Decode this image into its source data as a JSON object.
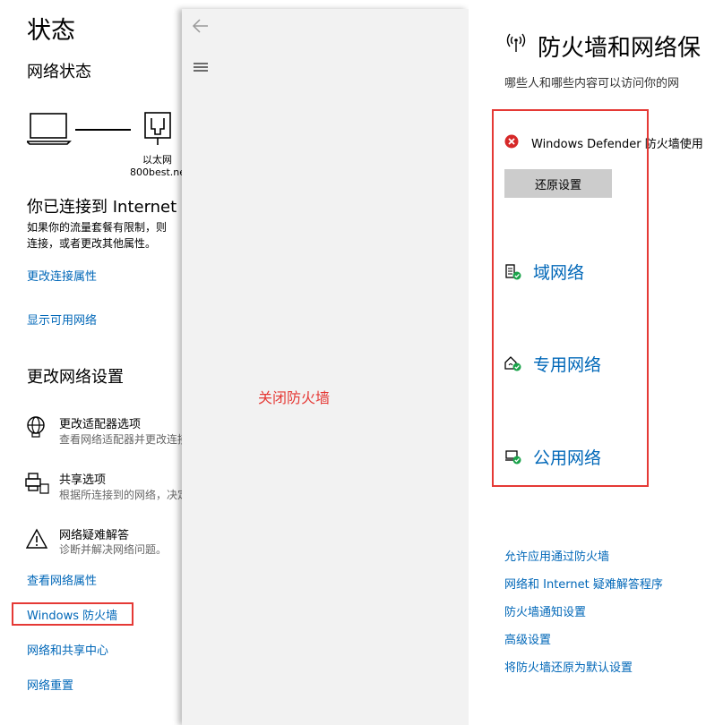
{
  "status_panel": {
    "title": "状态",
    "network_status_heading": "网络状态",
    "connection": {
      "adapter_name": "以太网",
      "network_name": "800best.net"
    },
    "connected_heading": "你已连接到 Internet",
    "connected_desc_line1": "如果你的流量套餐有限制，则",
    "connected_desc_line2": "连接，或者更改其他属性。",
    "change_connection_props": "更改连接属性",
    "show_available_networks": "显示可用网络",
    "change_settings_heading": "更改网络设置",
    "adapter_options": {
      "title": "更改适配器选项",
      "desc": "查看网络适配器并更改连接"
    },
    "sharing_options": {
      "title": "共享选项",
      "desc": "根据所连接到的网络，决定"
    },
    "troubleshoot": {
      "title": "网络疑难解答",
      "desc": "诊断并解决网络问题。"
    },
    "view_network_props": "查看网络属性",
    "windows_firewall": "Windows 防火墙",
    "network_sharing_center": "网络和共享中心",
    "network_reset": "网络重置"
  },
  "middle_panel": {
    "annotation": "关闭防火墙"
  },
  "firewall_panel": {
    "title": "防火墙和网络保",
    "subtitle": "哪些人和哪些内容可以访问你的网",
    "warning_text": "Windows Defender 防火墙使用",
    "restore_button": "还原设置",
    "networks": [
      {
        "label": "域网络",
        "icon": "domain-network-icon"
      },
      {
        "label": "专用网络",
        "icon": "private-network-icon"
      },
      {
        "label": "公用网络",
        "icon": "public-network-icon"
      }
    ],
    "links": [
      "允许应用通过防火墙",
      "网络和 Internet 疑难解答程序",
      "防火墙通知设置",
      "高级设置",
      "将防火墙还原为默认设置"
    ]
  },
  "colors": {
    "link": "#0067b8",
    "highlight": "#e53935",
    "annotation": "#e53935",
    "status_ok": "#1aa34a",
    "status_error": "#d62828"
  }
}
